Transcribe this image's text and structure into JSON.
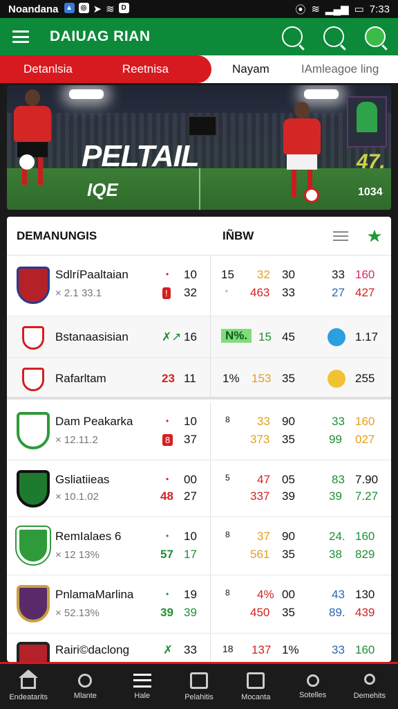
{
  "status_bar": {
    "carrier": "Noandana",
    "time": "7:33",
    "icons": [
      "app-icon",
      "settings-icon",
      "location-icon",
      "wifi-icon",
      "sim-icon"
    ]
  },
  "app_bar": {
    "title": "DAIUAG RIAN",
    "icons": [
      "search-icon",
      "search-alt-icon",
      "favorite-icon"
    ]
  },
  "tabs": [
    {
      "label": "Detanlsia",
      "active": true
    },
    {
      "label": "Reetnisa",
      "active": true
    },
    {
      "label": "Nayam",
      "active": false
    },
    {
      "label": "IAmleagoe ling",
      "active": false
    }
  ],
  "banner": {
    "title": "PELTAIL",
    "subtitle": "IQE",
    "card_rating": "47.",
    "card_number": "1034"
  },
  "standings": {
    "title": "DEMANUNGIS",
    "now_label": "IÑBW",
    "rows": [
      {
        "name": "SdlríPaaltaian",
        "sub": "× 2.1 33.1",
        "crest": "#b52129",
        "a1": "•",
        "a2": "10",
        "b1": "32",
        "c1": "15",
        "c2": "32",
        "c3": "30",
        "d1": "◦",
        "d2": "463",
        "d3": "33",
        "e1": "33",
        "e2": "160",
        "f1": "27",
        "f2": "427"
      },
      {
        "name": "Bstanaasisian",
        "crest": "#d41f1f",
        "a1": "✗↗",
        "a2": "16",
        "c1": "N%.",
        "c2": "15",
        "c3": "45",
        "e2": "1.17"
      },
      {
        "name": "Rafarltam",
        "crest": "#d41f1f",
        "a1": "23",
        "a2": "11",
        "c1": "1%",
        "c2": "153",
        "c3": "35",
        "e2": "255"
      },
      {
        "name": "Dam Peakarka",
        "sub": "× 12.11.2",
        "crest": "#2f9a3a",
        "a1": "•",
        "a2": "10",
        "b1": "37",
        "c1": "8",
        "c2": "33",
        "c3": "90",
        "d2": "373",
        "d3": "35",
        "e1": "33",
        "e2": "160",
        "f1": "99",
        "f2": "027"
      },
      {
        "name": "Gsliatiieas",
        "sub": "× 10.1.02",
        "crest": "#1e7a2e",
        "a1": "•",
        "a2": "00",
        "b0": "48",
        "b1": "27",
        "c1": "5",
        "c2": "47",
        "c3": "05",
        "d2": "337",
        "d3": "39",
        "e1": "83",
        "e2": "7.90",
        "f1": "39",
        "f2": "7.27"
      },
      {
        "name": "RemIalaes 6",
        "sub": "× 12 13%",
        "crest": "#2f9a3a",
        "a1": "•",
        "a2": "10",
        "b0": "57",
        "b1": "17",
        "c1": "8",
        "c2": "37",
        "c3": "90",
        "d2": "561",
        "d3": "35",
        "e1": "24.",
        "e2": "160",
        "f1": "38",
        "f2": "829"
      },
      {
        "name": "PnlamaMarlina",
        "sub": "× 52.13%",
        "crest": "#5a2a6a",
        "a1": "•",
        "a2": "19",
        "b0": "39",
        "b1": "39",
        "c1": "8",
        "c2": "4%",
        "c3": "00",
        "d2": "450",
        "d3": "35",
        "e1": "43",
        "e2": "130",
        "f1": "89.",
        "f2": "439"
      },
      {
        "name": "Rairi©daclong",
        "crest": "#b52129",
        "a1": "✗",
        "a2": "33",
        "c1": "18",
        "c2": "137",
        "c3": "1%",
        "e1": "33",
        "e2": "160"
      }
    ]
  },
  "bottom_nav": [
    {
      "label": "Endeatarits",
      "icon": "home-icon"
    },
    {
      "label": "Mlante",
      "icon": "search-icon"
    },
    {
      "label": "Hale",
      "icon": "menu-icon"
    },
    {
      "label": "Pelahitis",
      "icon": "clipboard-icon"
    },
    {
      "label": "Mocanta",
      "icon": "book-icon"
    },
    {
      "label": "Sotelles",
      "icon": "pin-icon"
    },
    {
      "label": "Demehits",
      "icon": "user-icon"
    }
  ],
  "colors": {
    "primary_green": "#0c8a3a",
    "accent_red": "#d71920",
    "text_red": "#d41f1f",
    "text_green": "#1c8f34",
    "text_blue": "#2a64b9"
  }
}
